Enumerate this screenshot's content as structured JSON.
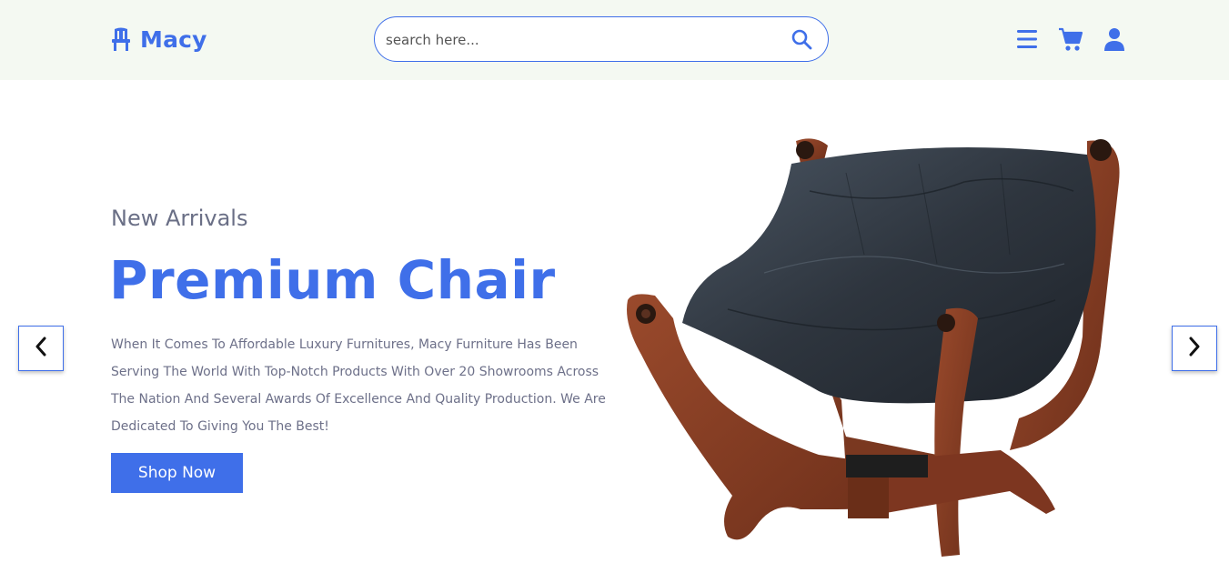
{
  "header": {
    "brand": "Macy",
    "search": {
      "placeholder": "search here..."
    }
  },
  "hero": {
    "subtitle": "New Arrivals",
    "title": "Premium Chair",
    "description": "When It Comes To Affordable Luxury Furnitures, Macy Furniture Has Been Serving The World With Top-Notch Products With Over 20 Showrooms Across The Nation And Several Awards Of Excellence And Quality Production. We Are Dedicated To Giving You The Best!",
    "cta_label": "Shop Now"
  },
  "icons": {
    "logo": "chair-icon",
    "search": "search-icon",
    "menu": "menu-icon",
    "cart": "cart-icon",
    "user": "user-icon",
    "prev": "chevron-left-icon",
    "next": "chevron-right-icon"
  },
  "colors": {
    "accent": "#3f6fe9",
    "header_bg": "#f4f9f2",
    "text_muted": "#6d7089"
  }
}
